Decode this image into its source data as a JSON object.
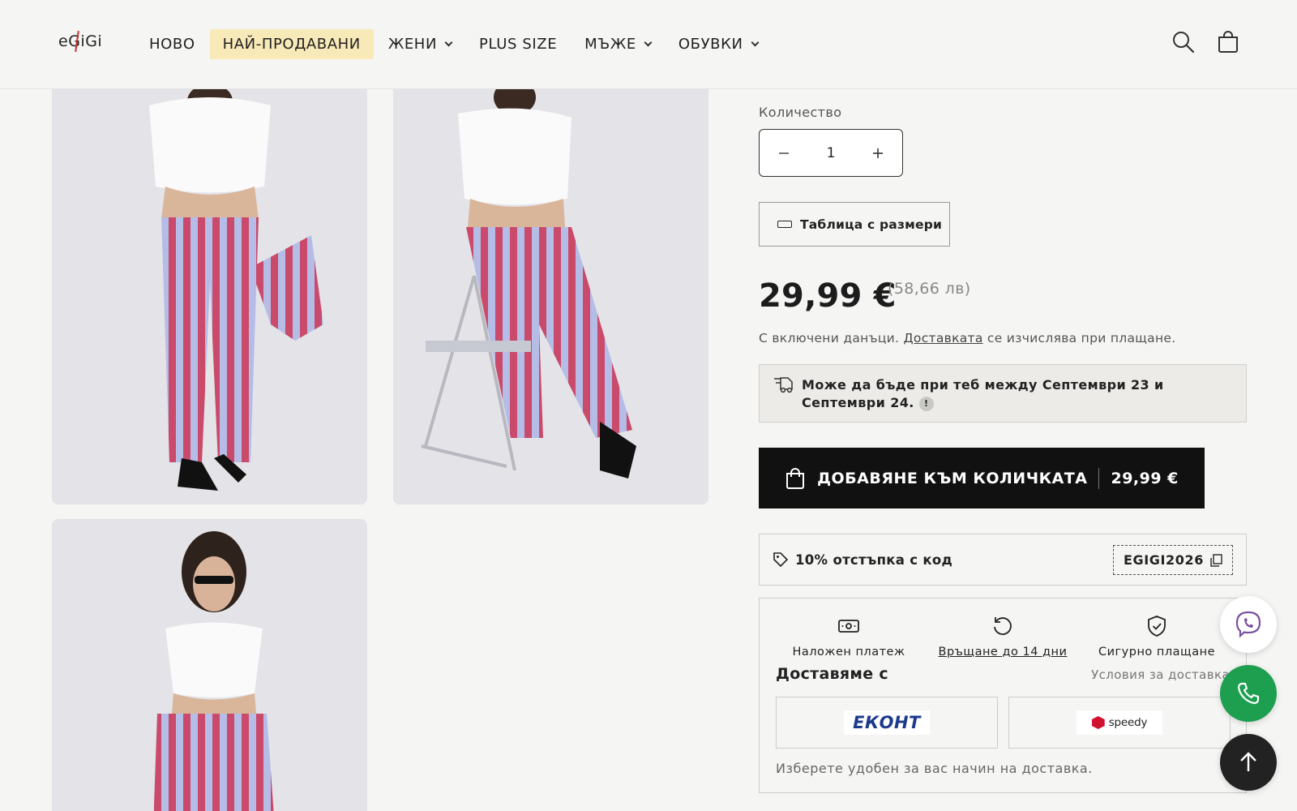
{
  "header": {
    "logo": "eGiGi",
    "nav": [
      {
        "label": "НОВО",
        "dropdown": false,
        "highlight": false
      },
      {
        "label": "НАЙ-ПРОДАВАНИ",
        "dropdown": false,
        "highlight": true
      },
      {
        "label": "ЖЕНИ",
        "dropdown": true,
        "highlight": false
      },
      {
        "label": "PLUS SIZE",
        "dropdown": false,
        "highlight": false
      },
      {
        "label": "МЪЖЕ",
        "dropdown": true,
        "highlight": false
      },
      {
        "label": "ОБУВКИ",
        "dropdown": true,
        "highlight": false
      }
    ],
    "icons": [
      "search-icon",
      "cart-icon"
    ]
  },
  "product": {
    "quantity_label": "Количество",
    "quantity_value": "1",
    "size_chart_label": "Таблица с размери",
    "price": "29,99 €",
    "price_bgn": "(58,66 лв)",
    "tax_note_prefix": "С включени данъци. ",
    "tax_note_link": "Доставката",
    "tax_note_suffix": " се изчислява при плащане.",
    "delivery_estimate_line1": "Може да бъде при теб между Септември 23 и",
    "delivery_estimate_line2": "Септември 24.",
    "delivery_info_badge": "!",
    "add_to_cart_label": "ДОБАВЯНЕ КЪМ КОЛИЧКАТА",
    "add_to_cart_price": "29,99 €",
    "promo_label": "10% отстъпка с код",
    "promo_code": "EGIGI2026"
  },
  "features": [
    {
      "label": "Наложен платеж",
      "icon": "cash-icon",
      "link": false
    },
    {
      "label": "Връщане до 14 дни",
      "icon": "return-icon",
      "link": true
    },
    {
      "label": "Сигурно плащане",
      "icon": "shield-check-icon",
      "link": false
    }
  ],
  "shipping": {
    "title": "Доставяме с",
    "conditions": "Условия за доставка",
    "carriers": [
      "ЕКОНТ",
      "speedy"
    ],
    "note": "Изберете удобен за вас начин на доставка."
  },
  "floating": [
    "viber-icon",
    "phone-icon",
    "arrow-up-icon"
  ],
  "colors": {
    "background": "#f5f5f4",
    "highlight": "#f8e9b8",
    "button_dark": "#111111",
    "phone_green": "#1e9e4f",
    "viber_purple": "#7b519d",
    "econt_blue": "#1c3a8c",
    "speedy_red": "#d1122f"
  }
}
